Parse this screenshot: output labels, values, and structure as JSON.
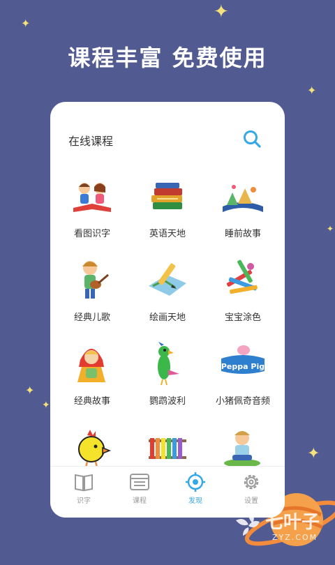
{
  "headline": "课程丰富  免费使用",
  "section": {
    "title": "在线课程"
  },
  "courses": [
    {
      "label": "看图识字",
      "icon": "kids-reading-icon"
    },
    {
      "label": "英语天地",
      "icon": "books-icon"
    },
    {
      "label": "睡前故事",
      "icon": "storybook-icon"
    },
    {
      "label": "经典儿歌",
      "icon": "boy-guitar-icon"
    },
    {
      "label": "绘画天地",
      "icon": "pencil-drawing-icon"
    },
    {
      "label": "宝宝涂色",
      "icon": "crayons-icon"
    },
    {
      "label": "经典故事",
      "icon": "girl-doll-icon"
    },
    {
      "label": "鹦鹉波利",
      "icon": "parrot-icon"
    },
    {
      "label": "小猪佩奇音频",
      "icon": "peppa-pig-logo-icon"
    },
    {
      "label": "",
      "icon": "chick-icon"
    },
    {
      "label": "",
      "icon": "xylophone-icon"
    },
    {
      "label": "",
      "icon": "boy-sitting-icon"
    }
  ],
  "peppa_logo_text": "Peppa Pig",
  "tabs": [
    {
      "label": "识字",
      "icon": "book-icon"
    },
    {
      "label": "课程",
      "icon": "course-list-icon"
    },
    {
      "label": "发现",
      "icon": "target-icon"
    },
    {
      "label": "设置",
      "icon": "gear-icon"
    }
  ],
  "active_tab": "发现",
  "watermark": {
    "text": "七叶子",
    "sub": "ZYZ.COM"
  },
  "colors": {
    "background": "#525b91",
    "accent": "#35a8e6",
    "star": "#f6e27a"
  }
}
